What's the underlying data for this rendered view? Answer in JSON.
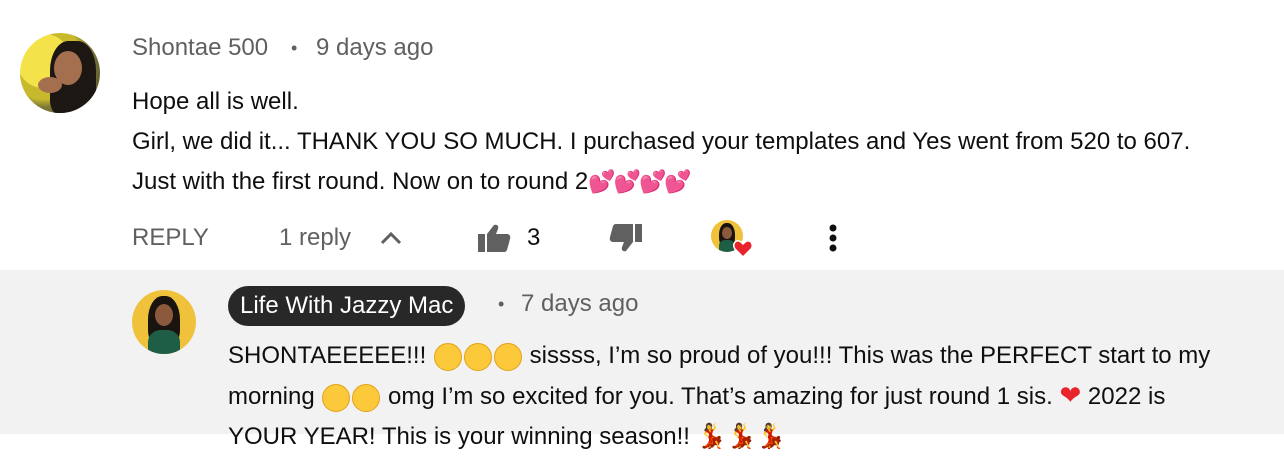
{
  "comment": {
    "author": "Shontae 500",
    "separator": "•",
    "time": "9 days ago",
    "lines": [
      "Hope all is well.",
      "Girl, we did it... THANK YOU SO MUCH. I purchased your templates and Yes went from 520 to 607.",
      "Just with the first round. Now on to round 2"
    ],
    "emoji_tail": "💕💕💕💕",
    "actions": {
      "reply_label": "REPLY",
      "replies_label": "1 reply",
      "like_count": "3"
    },
    "icons": [
      "thumbs-up-icon",
      "thumbs-down-icon",
      "creator-heart-icon",
      "more-vert-icon",
      "chevron-up-icon"
    ]
  },
  "reply": {
    "author": "Life With Jazzy Mac",
    "separator": "•",
    "time": "7 days ago",
    "line1_a": "SHONTAEEEEE!!! ",
    "line1_b": " sissss, I’m so proud of you!!! This was the PERFECT start to my",
    "line2_a": "morning ",
    "line2_b": " omg I’m so excited for you. That’s amazing for just round 1 sis. ",
    "line2_heart": "❤",
    "line2_c": " 2022 is",
    "line3": "YOUR YEAR! This is your winning season!! 💃💃💃"
  },
  "colors": {
    "secondary_text": "#606060",
    "reply_background": "#f2f2f2",
    "channel_chip": "#282828",
    "heart_red": "#e8232c"
  }
}
